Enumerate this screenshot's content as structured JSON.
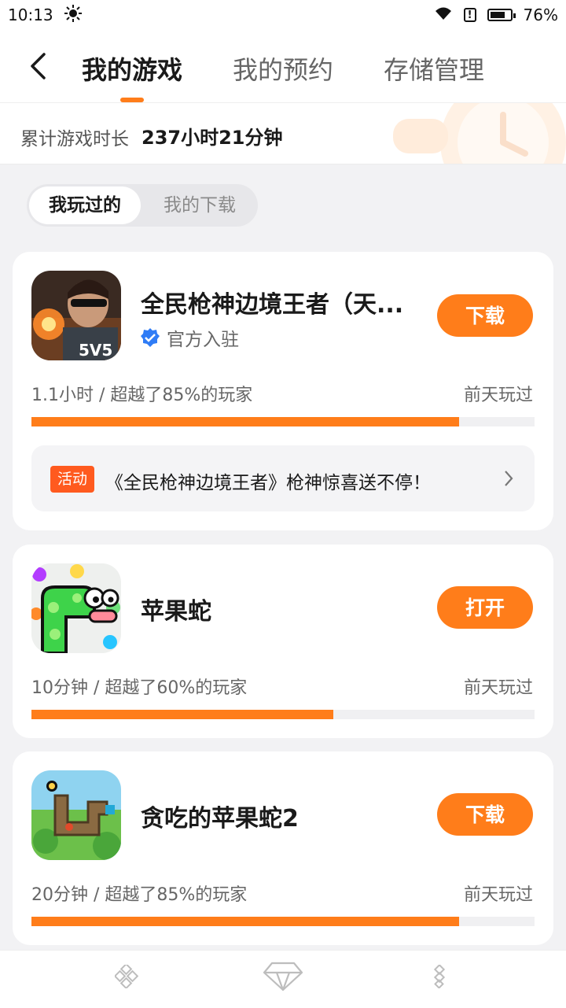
{
  "status_bar": {
    "time": "10:13",
    "battery": "76%",
    "battery_level": 0.76,
    "icons": [
      "brightness-icon",
      "wifi-icon",
      "alert-icon",
      "battery-icon"
    ]
  },
  "header": {
    "back_icon": "chevron-left-icon",
    "tabs": [
      "我的游戏",
      "我的预约",
      "存储管理"
    ],
    "active_tab": 0
  },
  "playtime": {
    "label": "累计游戏时长",
    "value": "237小时21分钟"
  },
  "segment": {
    "options": [
      "我玩过的",
      "我的下载"
    ],
    "active": 0
  },
  "accent_color": "#ff7d1a",
  "games": [
    {
      "title": "全民枪神边境王者（天...",
      "verified_label": "官方入驻",
      "button": "下载",
      "stats": "1.1小时 / 超越了85%的玩家",
      "last_played": "前天玩过",
      "progress": 0.85,
      "activity": {
        "tag": "活动",
        "text": "《全民枪神边境王者》枪神惊喜送不停！"
      },
      "icon_text": "5V5"
    },
    {
      "title": "苹果蛇",
      "button": "打开",
      "stats": "10分钟 / 超越了60%的玩家",
      "last_played": "前天玩过",
      "progress": 0.6
    },
    {
      "title": "贪吃的苹果蛇2",
      "button": "下载",
      "stats": "20分钟 / 超越了85%的玩家",
      "last_played": "前天玩过",
      "progress": 0.85
    }
  ],
  "bottom_nav": {
    "icons": [
      "game-pad-icon",
      "diamond-icon",
      "gift-icon"
    ]
  }
}
